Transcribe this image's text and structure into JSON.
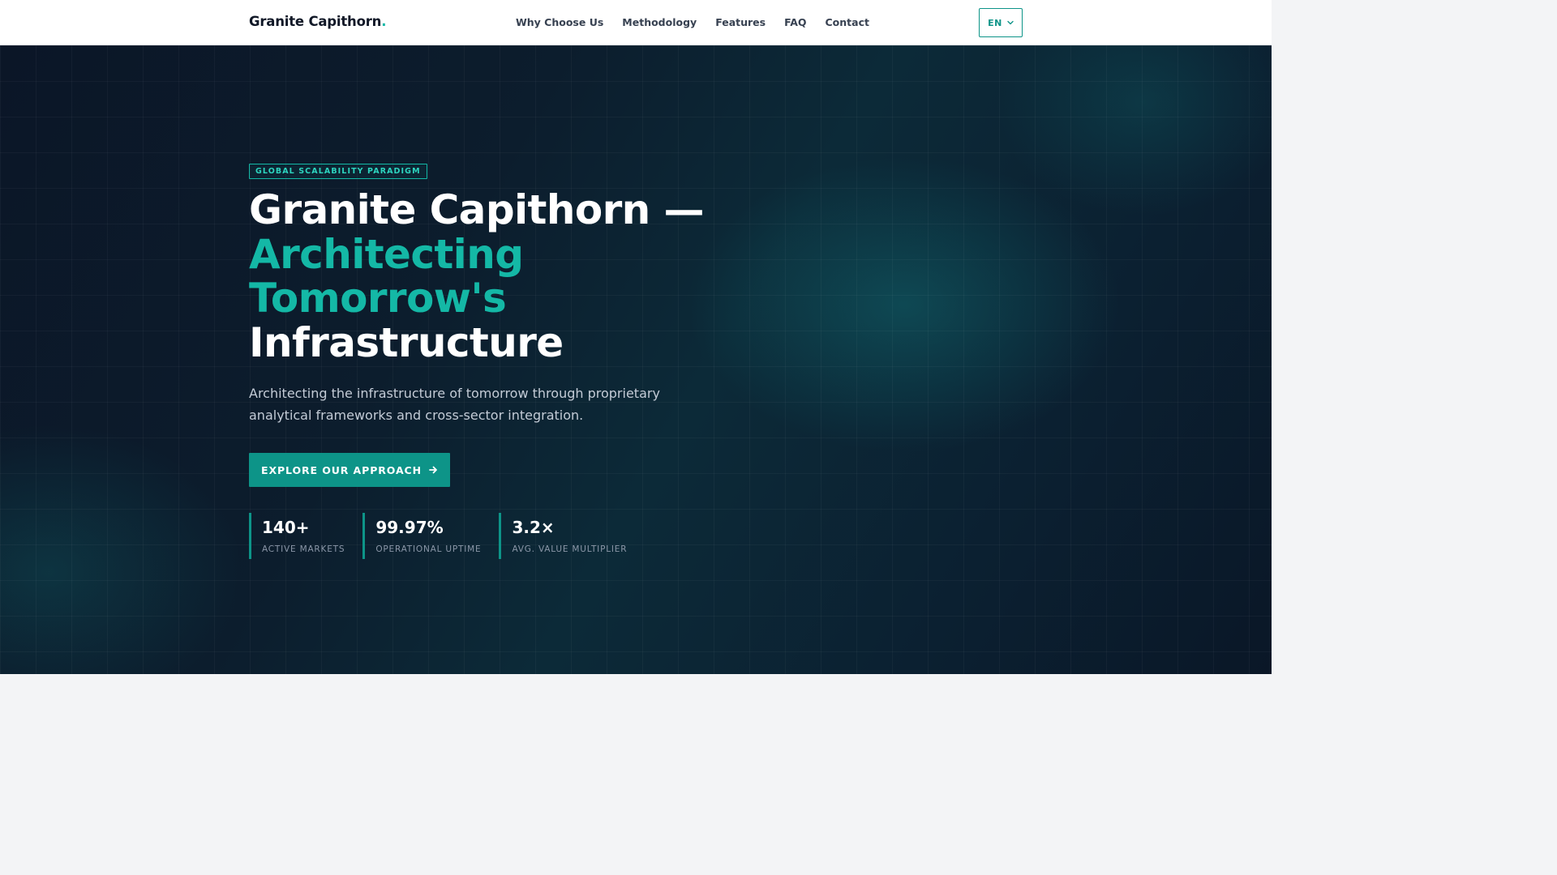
{
  "header": {
    "brand": "Granite Capithorn",
    "brand_dot": ".",
    "nav": [
      "Why Choose Us",
      "Methodology",
      "Features",
      "FAQ",
      "Contact"
    ],
    "language": "EN"
  },
  "hero": {
    "eyebrow": "GLOBAL SCALABILITY PARADIGM",
    "headline": {
      "line1": "Granite Capithorn —",
      "accent_line1": "Architecting",
      "accent_line2": "Tomorrow's",
      "line4": "Infrastructure"
    },
    "subtext": "Architecting the infrastructure of tomorrow through proprietary analytical frameworks and cross-sector integration.",
    "cta": "EXPLORE OUR APPROACH",
    "stats": [
      {
        "value": "140+",
        "label": "ACTIVE MARKETS"
      },
      {
        "value": "99.97%",
        "label": "OPERATIONAL UPTIME"
      },
      {
        "value": "3.2×",
        "label": "AVG. VALUE MULTIPLIER"
      }
    ]
  },
  "icons": {
    "language_chevron": "chevron-down-icon",
    "cta_arrow": "arrow-right-icon"
  },
  "colors": {
    "accent": "#14b8a6",
    "button": "#0d9488",
    "hero_bg": "#0b1627",
    "header_bg": "#ffffff"
  }
}
